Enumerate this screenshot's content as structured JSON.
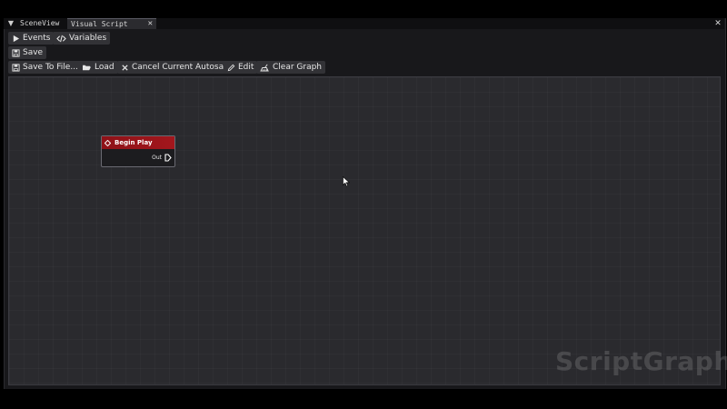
{
  "tabs": {
    "menu_icon": "triangle-down-icon",
    "items": [
      {
        "label": "SceneView",
        "active": false
      },
      {
        "label": "Visual Script Editor",
        "active": true
      }
    ],
    "close_glyph": "✕"
  },
  "toolbar_row1": {
    "events_label": "Events",
    "variables_label": "Variables"
  },
  "toolbar_row2": {
    "save_label": "Save"
  },
  "toolbar_row3": {
    "save_to_file_label": "Save To File...",
    "load_label": "Load",
    "cancel_autosave_label": "Cancel Current Autosave",
    "edit_label": "Edit",
    "clear_graph_label": "Clear Graph"
  },
  "graph": {
    "nodes": [
      {
        "title": "Begin Play",
        "header_color": "#a3161c",
        "output_pin_label": "Out"
      }
    ]
  },
  "watermark": "ScriptGraph",
  "colors": {
    "window_bg": "#18181b",
    "canvas_bg": "#2a2a2e",
    "button_bg": "#323236",
    "node_header": "#a3161c"
  }
}
